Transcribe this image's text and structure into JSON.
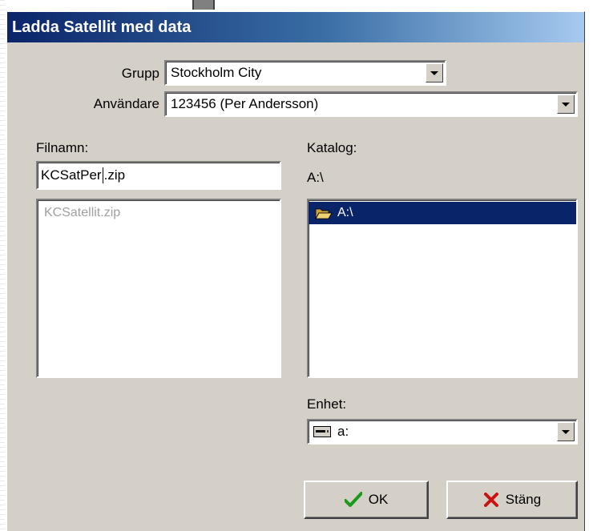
{
  "dialog": {
    "title": "Ladda Satellit med data"
  },
  "form": {
    "group_label": "Grupp",
    "group_value": "Stockholm City",
    "user_label": "Användare",
    "user_value": "123456 (Per Andersson)",
    "filename_label": "Filnamn:",
    "filename_value_before_caret": "KCSatPer",
    "filename_value_after_caret": ".zip",
    "file_list": [
      {
        "name": "KCSatellit.zip",
        "state": "disabled"
      }
    ],
    "directory_label": "Katalog:",
    "current_directory": "A:\\",
    "directory_list": [
      {
        "name": "A:\\",
        "icon": "open-folder-icon",
        "selected": true
      }
    ],
    "drive_label": "Enhet:",
    "drive_value": "a:",
    "drive_icon": "floppy-drive-icon"
  },
  "buttons": {
    "ok_label": "OK",
    "ok_icon": "checkmark-icon",
    "close_label": "Stäng",
    "close_icon": "x-icon"
  },
  "colors": {
    "dialog_bg": "#d4d0c8",
    "title_gradient_start": "#0a246a",
    "selection": "#0a246a",
    "ok_check": "#1a9a1a",
    "close_x": "#cc1111"
  }
}
